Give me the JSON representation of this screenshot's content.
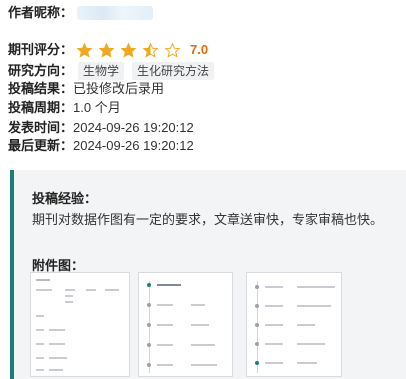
{
  "profile": {
    "author_label": "作者昵称：",
    "rating_label": "期刊评分：",
    "rating_value": 3.5,
    "rating_max": 5,
    "rating_score": "7.0",
    "direction_label": "研究方向：",
    "direction_tags": [
      "生物学",
      "生化研究方法"
    ],
    "result_label": "投稿结果：",
    "result_value": "已投修改后录用",
    "period_label": "投稿周期：",
    "period_value": "1.0 个月",
    "publish_label": "发表时间：",
    "publish_value": "2024-09-26 19:20:12",
    "update_label": "最后更新：",
    "update_value": "2024-09-26 19:20:12"
  },
  "experience": {
    "title": "投稿经验：",
    "text": "期刊对数据作图有一定的要求，文章送审快，专家审稿也快。",
    "attachments_title": "附件图："
  },
  "colors": {
    "star": "#f2a81d",
    "score": "#e06a0a",
    "accent": "#1a7f7a",
    "tag_bg": "#f0f1f3"
  },
  "icons": [
    "star-icon",
    "half-star-icon",
    "empty-star-icon"
  ]
}
